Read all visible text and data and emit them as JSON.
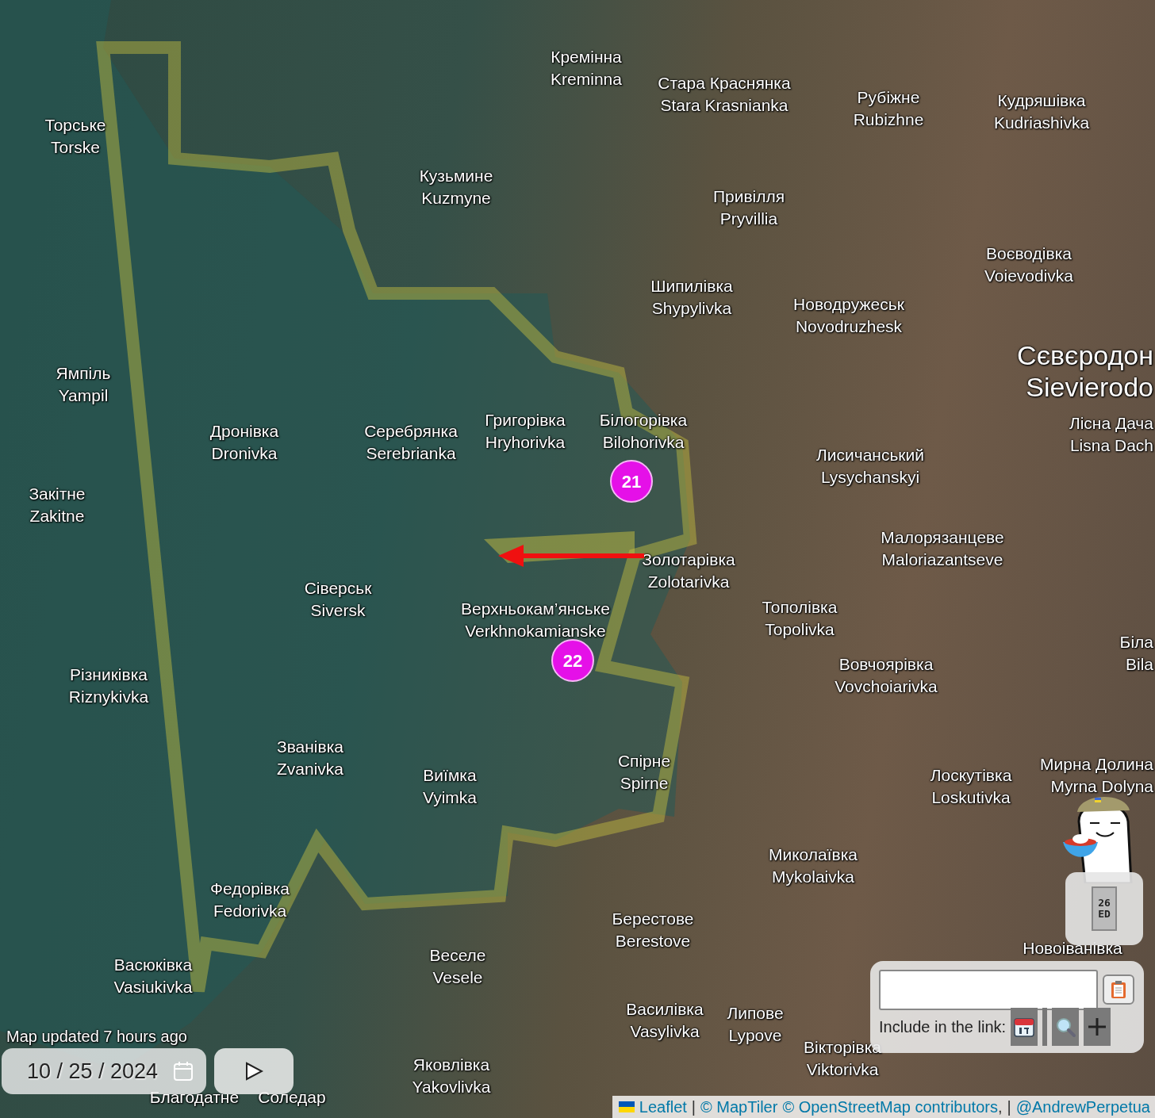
{
  "places": [
    {
      "uk": "Торське",
      "en": "Torske"
    },
    {
      "uk": "Кремінна",
      "en": "Kreminna"
    },
    {
      "uk": "Стара Краснянка",
      "en": "Stara Krasnianka"
    },
    {
      "uk": "Рубіжне",
      "en": "Rubizhne"
    },
    {
      "uk": "Кудряшівка",
      "en": "Kudriashivka"
    },
    {
      "uk": "Кузьмине",
      "en": "Kuzmyne"
    },
    {
      "uk": "Привілля",
      "en": "Pryvillia"
    },
    {
      "uk": "Воєводівка",
      "en": "Voievodivka"
    },
    {
      "uk": "Шипилівка",
      "en": "Shypylivka"
    },
    {
      "uk": "Новодружеськ",
      "en": "Novodruzhesk"
    },
    {
      "uk": "Ямпіль",
      "en": "Yampil"
    },
    {
      "uk": "Сєвєродон",
      "en": "Sievierodo"
    },
    {
      "uk": "Дронівка",
      "en": "Dronivka"
    },
    {
      "uk": "Серебрянка",
      "en": "Serebrianka"
    },
    {
      "uk": "Григорівка",
      "en": "Hryhorivka"
    },
    {
      "uk": "Білогорівка",
      "en": "Bilohorivka"
    },
    {
      "uk": "Лісна Дача",
      "en": "Lisna Dach"
    },
    {
      "uk": "Лисичанський",
      "en": "Lysychanskyi"
    },
    {
      "uk": "Закітне",
      "en": "Zakitne"
    },
    {
      "uk": "Малорязанцеве",
      "en": "Maloriazantseve"
    },
    {
      "uk": "Золотарівка",
      "en": "Zolotarivka"
    },
    {
      "uk": "Сіверськ",
      "en": "Siversk"
    },
    {
      "uk": "Верхньокам’янське",
      "en": "Verkhnokamianske"
    },
    {
      "uk": "Тополівка",
      "en": "Topolivka"
    },
    {
      "uk": "Біла",
      "en": "Bila"
    },
    {
      "uk": "Вовчоярівка",
      "en": "Vovchoiarivka"
    },
    {
      "uk": "Різниківка",
      "en": "Riznykivka"
    },
    {
      "uk": "Званівка",
      "en": "Zvanivka"
    },
    {
      "uk": "Спірне",
      "en": "Spirne"
    },
    {
      "uk": "Виїмка",
      "en": "Vyimka"
    },
    {
      "uk": "Лоскутівка",
      "en": "Loskutivka"
    },
    {
      "uk": "Мирна Долина",
      "en": "Myrna Dolyna"
    },
    {
      "uk": "Миколаївка",
      "en": "Mykolaivka"
    },
    {
      "uk": "Федорівка",
      "en": "Fedorivka"
    },
    {
      "uk": "Берестове",
      "en": "Berestove"
    },
    {
      "uk": "Новоіванівка"
    },
    {
      "uk": "Веселе",
      "en": "Vesele"
    },
    {
      "uk": "Васюківка",
      "en": "Vasiukivka"
    },
    {
      "uk": "Василівка",
      "en": "Vasylivka"
    },
    {
      "uk": "Липове",
      "en": "Lypove"
    },
    {
      "uk": "Вікторівка",
      "en": "Viktorivka"
    },
    {
      "uk": "Яковлівка",
      "en": "Yakovlivka"
    },
    {
      "uk": "Благодатне"
    },
    {
      "uk": "Соледар"
    }
  ],
  "markers": [
    {
      "label": "21"
    },
    {
      "label": "22"
    }
  ],
  "status": "Map updated 7 hours ago",
  "date": {
    "value": "10 / 25 / 2024"
  },
  "widget_button": {
    "lines": [
      "26",
      "ED"
    ]
  },
  "link_panel": {
    "label": "Include in the link:",
    "options": [
      {
        "kind": "date",
        "on": true
      },
      {
        "kind": "zoom",
        "on": true
      },
      {
        "kind": "center",
        "on": true
      }
    ]
  },
  "attribution": [
    {
      "kind": "link",
      "text": "Leaflet",
      "flag": true
    },
    {
      "kind": "sep",
      "text": "|"
    },
    {
      "kind": "link",
      "text": "© MapTiler"
    },
    {
      "kind": "link",
      "text": "© OpenStreetMap contributors"
    },
    {
      "kind": "text",
      "text": ","
    },
    {
      "kind": "sep",
      "text": "|"
    },
    {
      "kind": "link",
      "text": "@AndrewPerpetua"
    }
  ]
}
